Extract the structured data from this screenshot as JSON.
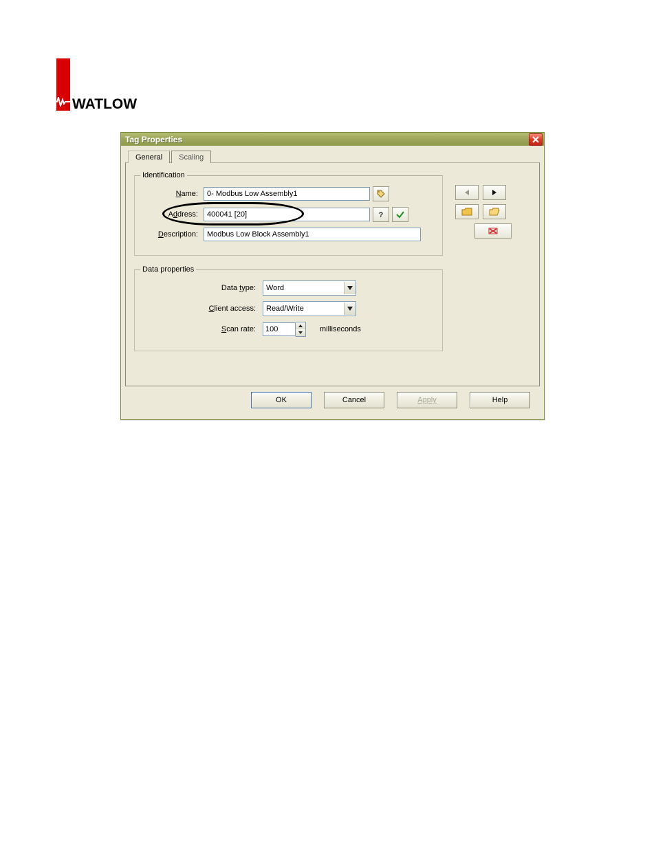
{
  "logo": {
    "brand": "WATLOW"
  },
  "dialog": {
    "title": "Tag Properties",
    "tabs": [
      {
        "label": "General",
        "active": true
      },
      {
        "label": "Scaling",
        "active": false
      }
    ],
    "groups": {
      "identification": {
        "legend": "Identification",
        "name_label_pre": "N",
        "name_label_post": "ame:",
        "name_value": "0- Modbus Low Assembly1",
        "address_label_pre": "A",
        "address_label_rest": "ddress:",
        "address_value": "400041 [20]",
        "description_label_pre": "D",
        "description_label_rest": "escription:",
        "description_value": "Modbus Low Block Assembly1"
      },
      "dataprops": {
        "legend": "Data properties",
        "datatype_label_pre": "Data ",
        "datatype_label_ul": "t",
        "datatype_label_post": "ype:",
        "datatype_value": "Word",
        "clientaccess_label_pre": "C",
        "clientaccess_label_rest": "lient access:",
        "clientaccess_value": "Read/Write",
        "scanrate_label_pre": "S",
        "scanrate_label_rest": "can rate:",
        "scanrate_value": "100",
        "scanrate_unit": "milliseconds"
      }
    },
    "buttons": {
      "ok": "OK",
      "cancel": "Cancel",
      "apply": "Apply",
      "help": "Help"
    },
    "nav_icons": {
      "prev": "back-icon",
      "next": "play-icon",
      "new": "folder-new-icon",
      "open": "folder-open-icon",
      "delete": "delete-icon",
      "help_hint": "help-icon",
      "ok_hint": "check-icon",
      "name_hint": "tag-icon"
    }
  }
}
